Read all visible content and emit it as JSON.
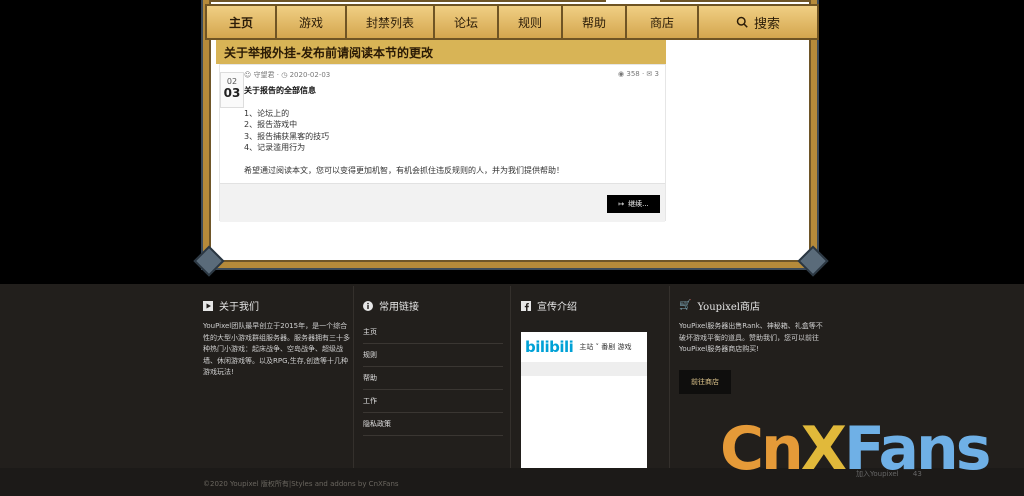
{
  "nav": {
    "items": [
      "主页",
      "游戏",
      "封禁列表",
      "论坛",
      "规则",
      "帮助",
      "商店"
    ],
    "search_label": "搜索"
  },
  "post": {
    "title": "关于举报外挂-发布前请阅读本节的更改",
    "date_month": "02",
    "date_day": "03",
    "author": "守望君",
    "date": "2020-02-03",
    "views": "358",
    "replies": "3",
    "heading": "关于报告的全部信息",
    "items": [
      "1、论坛上的",
      "2、报告游戏中",
      "3、报告捕获黑客的技巧",
      "4、记录滥用行为"
    ],
    "closing": "希望通过阅读本文，您可以变得更加机智，有机会抓住违反规则的人，并为我们提供帮助！",
    "continue_label": "继续..."
  },
  "footer": {
    "about": {
      "title": "关于我们",
      "text": "YouPixel团队最早创立于2015年，是一个综合性的大型小游戏群组服务器。服务器拥有三十多种热门小游戏：起床战争、空岛战争、超级战墙、休闲游戏等。以及RPG,生存,创造等十几种游戏玩法!"
    },
    "links": {
      "title": "常用链接",
      "items": [
        "主页",
        "规则",
        "帮助",
        "工作",
        "隐私政策"
      ]
    },
    "promo": {
      "title": "宣传介绍",
      "logo": "bilibili",
      "menu": "主站 ˅   番剧   游戏"
    },
    "shop": {
      "title": "Youpixel商店",
      "text": "YouPixel服务器出售Rank、神秘箱、礼盒等不破坏游戏平衡的道具。赞助我们，您可以前往YouPixel服务器商店购买!",
      "button": "前往商店"
    },
    "copyright": "©2020 Youpixel 版权所有|Styles and addons by CnXFans",
    "watermark_text": "加入Youpixel",
    "watermark_num": "43"
  },
  "watermark": {
    "parts": [
      "Cn",
      "X",
      "Fans"
    ]
  },
  "colors": {
    "gold": "#d8ad5a",
    "footer_bg": "#221f1c",
    "bili_blue": "#00a1d6"
  }
}
